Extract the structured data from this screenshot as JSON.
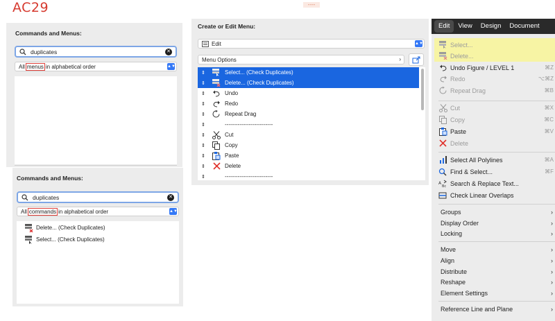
{
  "header": {
    "title": "AC29",
    "deco": "----"
  },
  "panel1": {
    "title": "Commands and Menus:",
    "search_value": "duplicates",
    "filter_prefix": "All",
    "filter_highlight": "menus",
    "filter_suffix": "in alphabetical order"
  },
  "panel2": {
    "title": "Commands and Menus:",
    "search_value": "duplicates",
    "filter_prefix": "All",
    "filter_highlight": "commands",
    "filter_suffix": "in alphabetical order",
    "items": [
      {
        "label": "Delete... (Check Duplicates)"
      },
      {
        "label": "Select... (Check Duplicates)"
      }
    ]
  },
  "editor": {
    "title": "Create or Edit Menu:",
    "menu_select": "Edit",
    "menu_options_label": "Menu Options",
    "rows": [
      {
        "label": "Select... (Check Duplicates)",
        "icon": "select-dup-icon",
        "selected": true
      },
      {
        "label": "Delete... (Check Duplicates)",
        "icon": "delete-dup-icon",
        "selected": true
      },
      {
        "label": "Undo",
        "icon": "undo-icon",
        "selected": false
      },
      {
        "label": "Redo",
        "icon": "redo-icon",
        "selected": false
      },
      {
        "label": "Repeat Drag",
        "icon": "repeat-icon",
        "selected": false
      },
      {
        "label": "--------------------------",
        "icon": "",
        "selected": false
      },
      {
        "label": "Cut",
        "icon": "scissors-icon",
        "selected": false
      },
      {
        "label": "Copy",
        "icon": "copy-icon",
        "selected": false
      },
      {
        "label": "Paste",
        "icon": "paste-icon",
        "selected": false
      },
      {
        "label": "Delete",
        "icon": "x-icon",
        "selected": false
      },
      {
        "label": "--------------------------",
        "icon": "",
        "selected": false
      }
    ]
  },
  "menubar": {
    "items": [
      "Edit",
      "View",
      "Design",
      "Document"
    ]
  },
  "edit_menu": {
    "items": [
      {
        "label": "Select...",
        "shortcut": "",
        "disabled": true,
        "highlight": true,
        "icon": "select-dup-icon"
      },
      {
        "label": "Delete...",
        "shortcut": "",
        "disabled": true,
        "highlight": true,
        "icon": "delete-dup-icon"
      },
      {
        "label": "Undo Figure / LEVEL 1",
        "shortcut": "⌘Z",
        "disabled": false,
        "icon": "undo-icon"
      },
      {
        "label": "Redo",
        "shortcut": "⌥⌘Z",
        "disabled": true,
        "icon": "redo-icon"
      },
      {
        "label": "Repeat Drag",
        "shortcut": "⌘B",
        "disabled": true,
        "icon": "repeat-icon"
      },
      {
        "label": "Cut",
        "shortcut": "⌘X",
        "disabled": true,
        "icon": "scissors-icon"
      },
      {
        "label": "Copy",
        "shortcut": "⌘C",
        "disabled": true,
        "icon": "copy-icon"
      },
      {
        "label": "Paste",
        "shortcut": "⌘V",
        "disabled": false,
        "icon": "paste-icon"
      },
      {
        "label": "Delete",
        "shortcut": "",
        "disabled": true,
        "icon": "x-icon"
      },
      {
        "label": "Select All Polylines",
        "shortcut": "⌘A",
        "disabled": false,
        "icon": "select-all-icon"
      },
      {
        "label": "Find & Select...",
        "shortcut": "⌘F",
        "disabled": false,
        "icon": "find-select-icon"
      },
      {
        "label": "Search & Replace Text...",
        "shortcut": "",
        "disabled": false,
        "icon": "search-replace-icon"
      },
      {
        "label": "Check Linear Overlaps",
        "shortcut": "",
        "disabled": false,
        "icon": "linear-overlaps-icon"
      },
      {
        "label": "Groups"
      },
      {
        "label": "Display Order"
      },
      {
        "label": "Locking"
      },
      {
        "label": "Move"
      },
      {
        "label": "Align"
      },
      {
        "label": "Distribute"
      },
      {
        "label": "Reshape"
      },
      {
        "label": "Element Settings"
      },
      {
        "label": "Reference Line and Plane"
      }
    ]
  },
  "colors": {
    "accent": "#1a66e0",
    "title_red": "#d63a2f",
    "highlight_yellow": "#f7f4a4",
    "menubar_bg": "#2a2a2a"
  }
}
